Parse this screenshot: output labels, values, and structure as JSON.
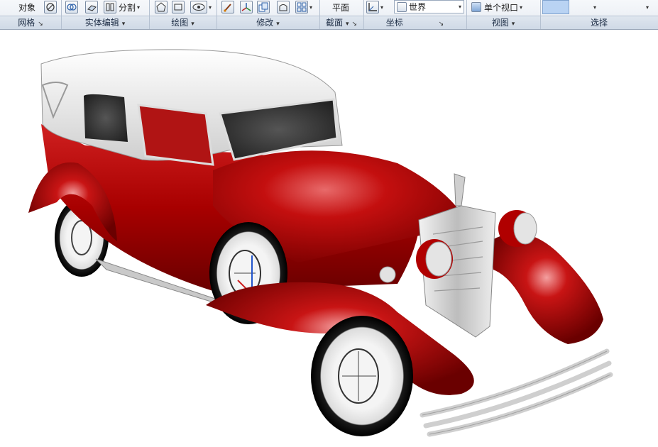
{
  "ribbon": {
    "tools": {
      "object_label": "对象",
      "split_label": "分割",
      "view_plan": "平面",
      "world_label": "世界",
      "single_viewport": "单个视口"
    },
    "panels": [
      {
        "id": "mesh",
        "label": "网格"
      },
      {
        "id": "solid-edit",
        "label": "实体编辑"
      },
      {
        "id": "draw",
        "label": "绘图"
      },
      {
        "id": "modify",
        "label": "修改"
      },
      {
        "id": "section",
        "label": "截面"
      },
      {
        "id": "coordinates",
        "label": "坐标"
      },
      {
        "id": "view",
        "label": "视图"
      },
      {
        "id": "select",
        "label": "选择"
      }
    ]
  },
  "viewport": {
    "model": "3D vintage red sedan with white roof",
    "colors": {
      "body": "#a80000",
      "roof": "#e8e8e8",
      "tire": "#111111",
      "chrome": "#d0d0d0"
    }
  }
}
